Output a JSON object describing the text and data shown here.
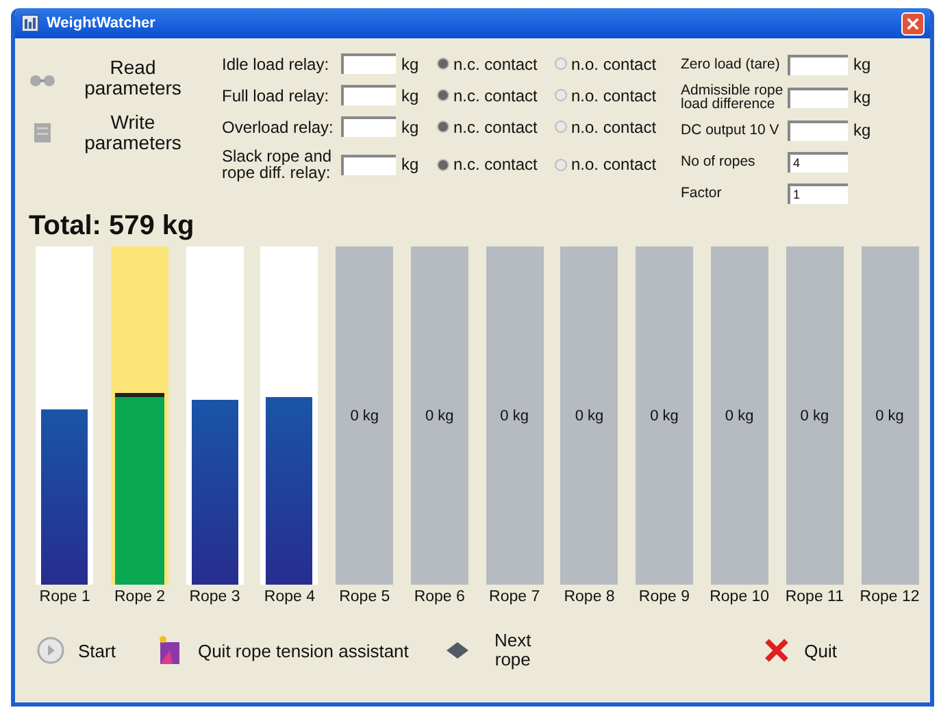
{
  "window": {
    "title": "WeightWatcher"
  },
  "actions": [
    {
      "label": "Read parameters",
      "kind": "read"
    },
    {
      "label": "Write parameters",
      "kind": "write"
    }
  ],
  "relays": [
    {
      "label": "Idle load relay:",
      "unit": "kg",
      "contacts": [
        {
          "label": "n.c. contact",
          "selected": true
        },
        {
          "label": "n.o. contact",
          "selected": false
        }
      ]
    },
    {
      "label": "Full load relay:",
      "unit": "kg",
      "contacts": [
        {
          "label": "n.c. contact",
          "selected": true
        },
        {
          "label": "n.o. contact",
          "selected": false
        }
      ]
    },
    {
      "label": "Overload relay:",
      "unit": "kg",
      "contacts": [
        {
          "label": "n.c. contact",
          "selected": true
        },
        {
          "label": "n.o. contact",
          "selected": false
        }
      ]
    },
    {
      "label": "Slack rope and rope diff. relay:",
      "unit": "kg",
      "contacts": [
        {
          "label": "n.c. contact",
          "selected": true
        },
        {
          "label": "n.o. contact",
          "selected": false
        }
      ]
    }
  ],
  "settings": [
    {
      "label": "Zero load (tare)",
      "unit": "kg"
    },
    {
      "label": "Admissible rope load difference",
      "unit": "kg"
    },
    {
      "label": "DC output 10 V",
      "unit": "kg"
    },
    {
      "label": "No of ropes",
      "value": "4"
    },
    {
      "label": "Factor",
      "value": "1"
    }
  ],
  "total": "Total: 579 kg",
  "ropes": [
    {
      "label": "Rope 1",
      "kind": "active",
      "level": 0.52,
      "alarm": false
    },
    {
      "label": "Rope 2",
      "kind": "active",
      "level": 0.555,
      "alarm": true
    },
    {
      "label": "Rope 3",
      "kind": "active",
      "level": 0.545,
      "alarm": false
    },
    {
      "label": "Rope 4",
      "kind": "active",
      "level": 0.555,
      "alarm": false
    },
    {
      "label": "Rope 5",
      "kind": "idle",
      "reading": "0 kg"
    },
    {
      "label": "Rope 6",
      "kind": "idle",
      "reading": "0 kg"
    },
    {
      "label": "Rope 7",
      "kind": "idle",
      "reading": "0 kg"
    },
    {
      "label": "Rope 8",
      "kind": "idle",
      "reading": "0 kg"
    },
    {
      "label": "Rope 9",
      "kind": "idle",
      "reading": "0 kg"
    },
    {
      "label": "Rope 10",
      "kind": "idle",
      "reading": "0 kg"
    },
    {
      "label": "Rope 11",
      "kind": "idle",
      "reading": "0 kg"
    },
    {
      "label": "Rope 12",
      "kind": "idle",
      "reading": "0 kg"
    }
  ],
  "buttons": [
    {
      "label": "Start",
      "kind": "start"
    },
    {
      "label": "Quit rope tension assistant",
      "kind": "assistant"
    },
    {
      "label": "Next rope",
      "kind": "next"
    },
    {
      "label": "Quit",
      "kind": "quit"
    }
  ]
}
